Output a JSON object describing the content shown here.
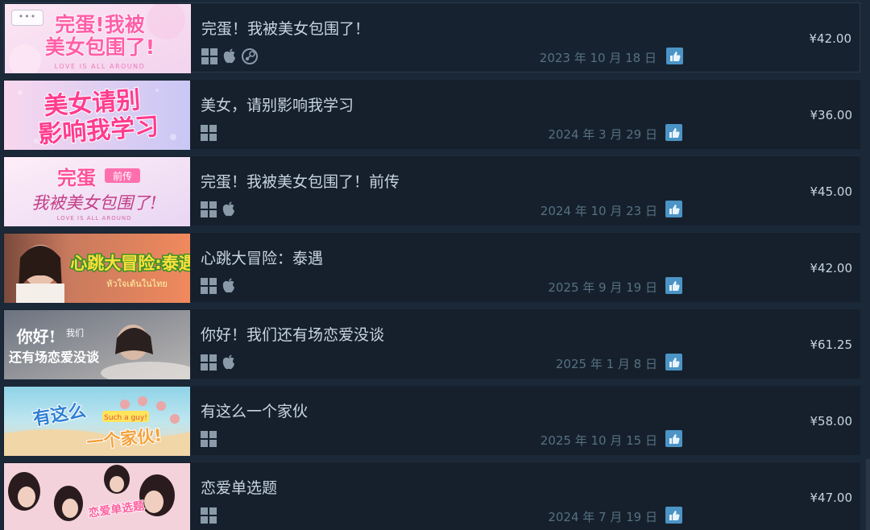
{
  "games": [
    {
      "title": "完蛋！我被美女包围了！",
      "capsule_text": [
        "完蛋!我被",
        "美女包围了!",
        "LOVE IS ALL AROUND"
      ],
      "platforms": [
        "windows-icon",
        "apple-icon",
        "steam-icon"
      ],
      "release_date": "2023 年 10 月 18 日",
      "price": "¥42.00"
    },
    {
      "title": "美女，请别影响我学习",
      "capsule_text": [
        "美女请别",
        "影响我学习"
      ],
      "platforms": [
        "windows-icon"
      ],
      "release_date": "2024 年 3 月 29 日",
      "price": "¥36.00"
    },
    {
      "title": "完蛋！我被美女包围了！前传",
      "capsule_text": [
        "完蛋",
        "前传",
        "我被美女包围了!",
        "LOVE IS ALL AROUND"
      ],
      "platforms": [
        "windows-icon",
        "apple-icon"
      ],
      "release_date": "2024 年 10 月 23 日",
      "price": "¥45.00"
    },
    {
      "title": "心跳大冒险：泰遇",
      "capsule_text": [
        "心跳大冒险:泰遇",
        "หัวใจเต้นในไทย"
      ],
      "platforms": [
        "windows-icon",
        "apple-icon"
      ],
      "release_date": "2025 年 9 月 19 日",
      "price": "¥42.00"
    },
    {
      "title": "你好！我们还有场恋爱没谈",
      "capsule_text": [
        "你好!",
        "我们",
        "还有场恋爱没谈"
      ],
      "platforms": [
        "windows-icon",
        "apple-icon"
      ],
      "release_date": "2025 年 1 月 8 日",
      "price": "¥61.25"
    },
    {
      "title": "有这么一个家伙",
      "capsule_text": [
        "有这么",
        "一个家伙!",
        "Such a guy!"
      ],
      "platforms": [
        "windows-icon"
      ],
      "release_date": "2025 年 10 月 15 日",
      "price": "¥58.00"
    },
    {
      "title": "恋爱单选题",
      "capsule_text": [
        "恋爱单选题"
      ],
      "platforms": [
        "windows-icon"
      ],
      "release_date": "2024 年 7 月 19 日",
      "price": "¥47.00"
    }
  ],
  "first_capsule_menu": "•••",
  "colors": {
    "page_bg": "#1b2838",
    "row_bg": "#16202d",
    "title": "#c7d5e0",
    "date": "#56707f",
    "platform_icon": "#8a9aa8",
    "thumb_bg": "#4b94c5"
  }
}
